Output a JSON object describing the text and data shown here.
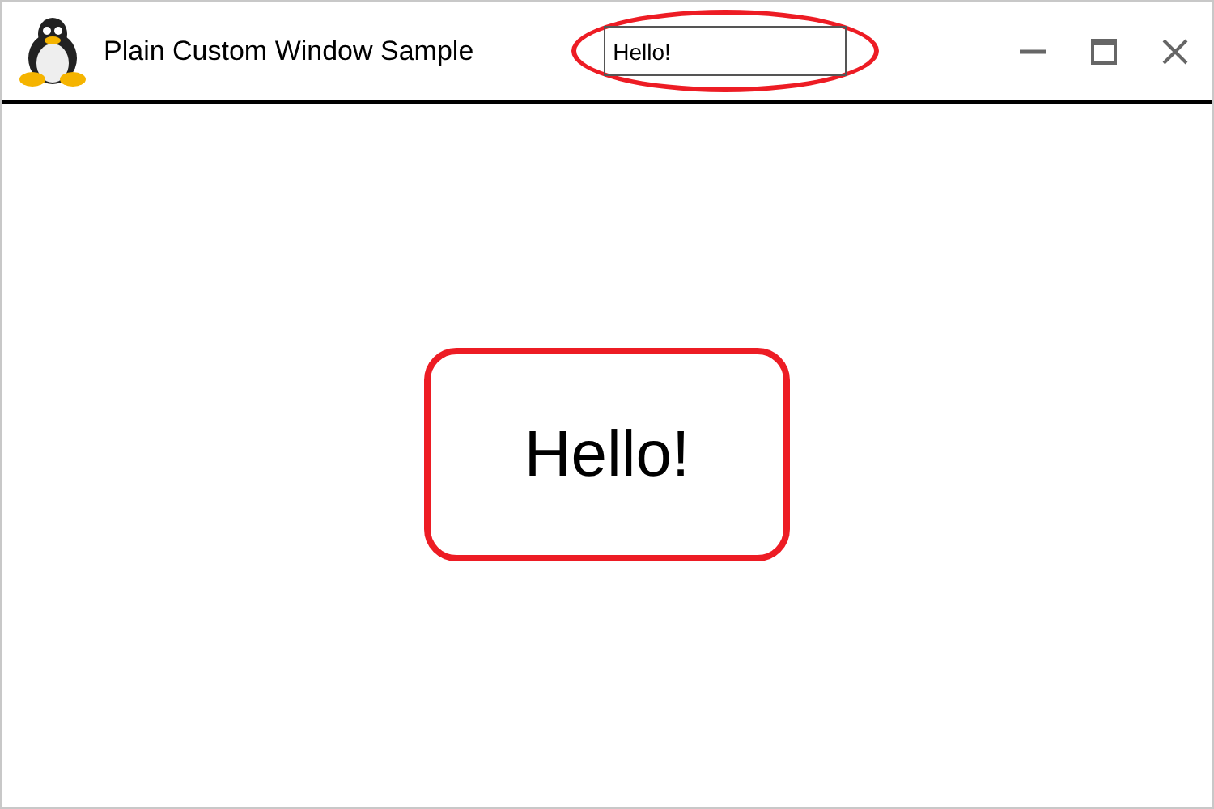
{
  "window": {
    "title": "Plain Custom Window Sample"
  },
  "title_bar_field": {
    "value": "Hello!"
  },
  "content": {
    "label": "Hello!"
  }
}
